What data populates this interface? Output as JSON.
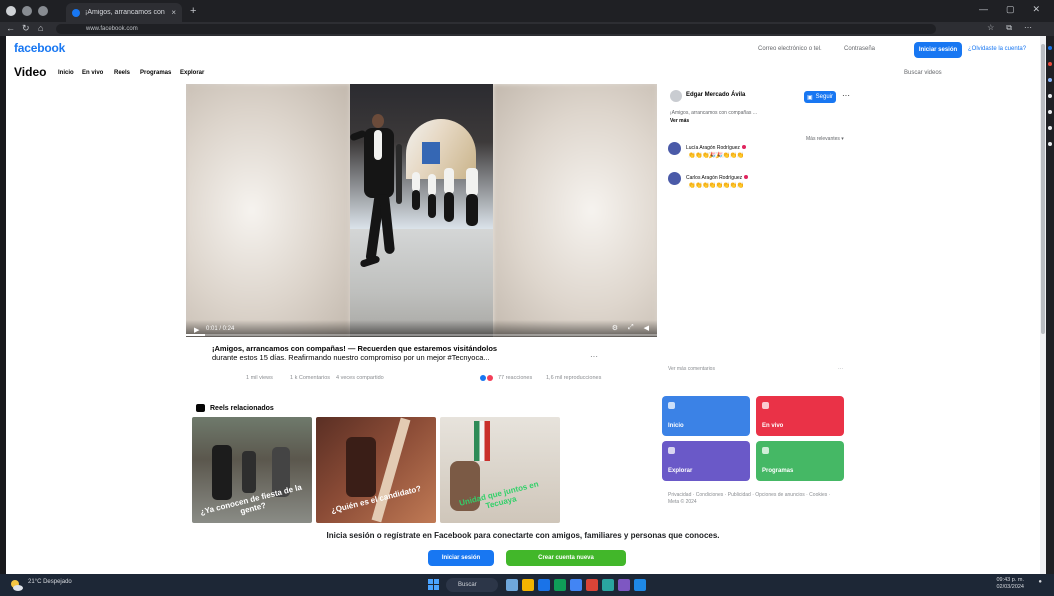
{
  "browser": {
    "tab_title": "¡Amigos, arrancamos con ...",
    "tab_close": "×",
    "new_tab": "+",
    "url": "www.facebook.com",
    "window_controls": [
      "—",
      "▢",
      "✕"
    ]
  },
  "header": {
    "logo": "facebook",
    "email_hint": "Correo electrónico o tel.",
    "password_hint": "Contraseña",
    "login_label": "Iniciar sesión",
    "register_link": "¿Olvidaste la cuenta?"
  },
  "video_nav": {
    "title": "Video",
    "items": [
      "Inicio",
      "En vivo",
      "Reels",
      "Programas",
      "Explorar"
    ],
    "search": "Buscar videos"
  },
  "player": {
    "time": "0:01 / 0:24",
    "progress": 0.04,
    "play_icon": "play-icon",
    "right_controls": [
      "settings-icon",
      "fullscreen-icon",
      "volume-icon"
    ]
  },
  "caption": {
    "line1": "¡Amigos, arrancamos con compañas! — Recuerden que estaremos visitándolos",
    "line2": "durante estos 15 días. Reafirmando nuestro compromiso por un mejor #Tecnyoca...",
    "more": "···"
  },
  "stats": {
    "views": "1 mil views",
    "comments": "1 k Comentarios",
    "shares": "4 veces compartido",
    "reactions": "77 reacciones",
    "watch": "1,6 mil reproducciones"
  },
  "reels": {
    "title": "Reels relacionados",
    "items": [
      {
        "overlay": "¿Ya conocen de fiesta de la gente?"
      },
      {
        "overlay": "¿Quién es el candidato?"
      },
      {
        "overlay": "Unidad que juntos en Tecuaya"
      }
    ]
  },
  "sidebar": {
    "name": "Edgar Mercado Ávila",
    "follow": "Seguir",
    "more_icon": "···",
    "desc": "¡Amigos, arrancamos con compañas ...",
    "see_more": "Ver más",
    "most_relevant": "Más relevantes ▾",
    "comments": [
      {
        "name": "Lucía Aragón Rodríguez",
        "emojis": "👏👏👏🎉🎉👏👏👏"
      },
      {
        "name": "Carlos Aragón Rodríguez",
        "emojis": "👏👏👏👏👏👏👏👏"
      }
    ],
    "section_left": "Ver más comentarios",
    "section_right": "···",
    "tiles": [
      {
        "label": "Inicio",
        "color": "#3b82e6"
      },
      {
        "label": "En vivo",
        "color": "#ea3247"
      },
      {
        "label": "Explorar",
        "color": "#6a59c8"
      },
      {
        "label": "Programas",
        "color": "#45b865"
      }
    ],
    "legal": "Privacidad · Condiciones · Publicidad · Opciones de anuncios · Cookies · Meta © 2024"
  },
  "login_prompt": {
    "message": "Inicia sesión o regístrate en Facebook para conectarte con amigos, familiares y personas que conoces.",
    "login": "Iniciar sesión",
    "register": "Crear cuenta nueva"
  },
  "taskbar": {
    "weather": "21°C Despejado",
    "search": "Buscar",
    "time": "09:43 p. m.",
    "date": "02/03/2024"
  },
  "colors": {
    "brand": "#1877f2",
    "register": "#42b72a"
  }
}
